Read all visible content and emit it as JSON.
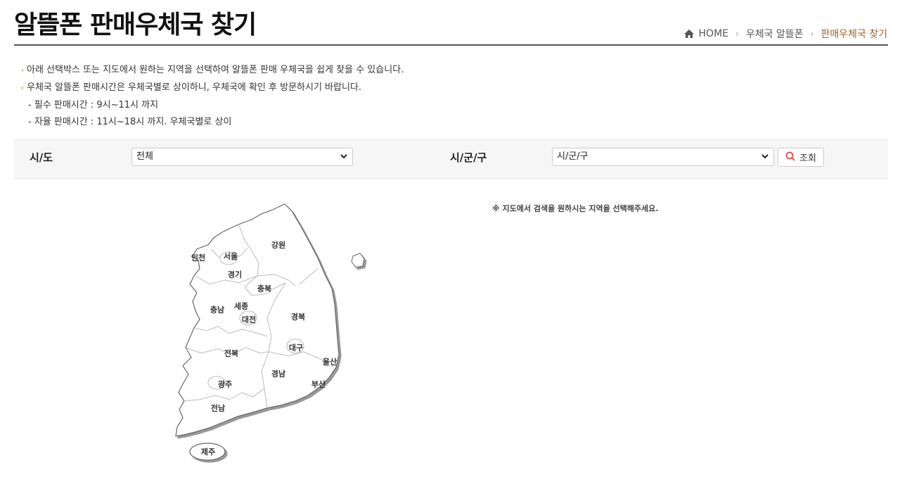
{
  "page": {
    "title": "알뜰폰 판매우체국 찾기"
  },
  "breadcrumb": {
    "home": "HOME",
    "level1": "우체국 알뜰폰",
    "current": "판매우체국 찾기"
  },
  "notes": {
    "line1": "아래 선택박스 또는 지도에서 원하는 지역을 선택하여 알뜰폰 판매 우체국을 쉽게 찾을 수 있습니다.",
    "line2": "우체국 알뜰폰 판매시간은 우체국별로 상이하니, 우체국에 확인 후 방문하시기 바랍니다.",
    "line3": "- 필수 판매시간 :  9시~11시 까지",
    "line4": "- 자율 판매시간 : 11시~18시 까지. 우체국별로 상이"
  },
  "filter": {
    "sido_label": "시/도",
    "sido_value": "전체",
    "sigungu_label": "시/군/구",
    "sigungu_value": "시/군/구",
    "search_label": "조회"
  },
  "hint": "※ 지도에서 검색을 원하시는 지역을 선택해주세요.",
  "map": {
    "regions": {
      "incheon": "인천",
      "seoul": "서울",
      "gangwon": "강원",
      "gyeonggi": "경기",
      "chungbuk": "충북",
      "chungnam": "충남",
      "sejong": "세종",
      "daejeon": "대전",
      "gyeongbuk": "경북",
      "daegu": "대구",
      "jeonbuk": "전북",
      "ulsan": "울산",
      "gyeongnam": "경남",
      "gwangju": "광주",
      "busan": "부산",
      "jeonnam": "전남",
      "jeju": "제주"
    }
  },
  "colors": {
    "accent": "#a0622a",
    "bullet": "#d08030",
    "search_icon": "#e05050"
  }
}
